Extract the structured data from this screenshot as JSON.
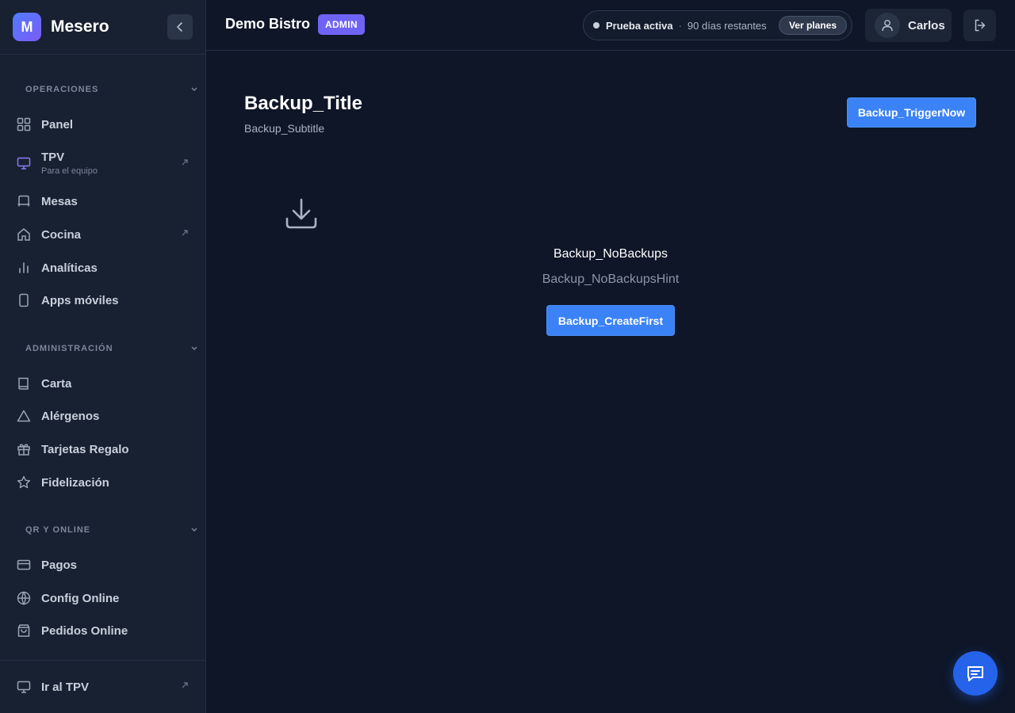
{
  "sidebar": {
    "logo_letter": "M",
    "app_name": "Mesero",
    "sections": [
      {
        "title": "OPERACIONES",
        "items": [
          {
            "label": "Panel",
            "icon": "grid-icon"
          },
          {
            "label": "TPV",
            "sublabel": "Para el equipo",
            "icon": "monitor-icon",
            "external": true,
            "accent": "#8b7cf6"
          },
          {
            "label": "Mesas",
            "icon": "table-icon"
          },
          {
            "label": "Cocina",
            "icon": "home-icon",
            "external": true
          },
          {
            "label": "Analíticas",
            "icon": "bar-chart-icon"
          },
          {
            "label": "Apps móviles",
            "icon": "smartphone-icon"
          }
        ]
      },
      {
        "title": "ADMINISTRACIÓN",
        "items": [
          {
            "label": "Carta",
            "icon": "book-icon"
          },
          {
            "label": "Alérgenos",
            "icon": "warning-icon"
          },
          {
            "label": "Tarjetas Regalo",
            "icon": "gift-icon"
          },
          {
            "label": "Fidelización",
            "icon": "star-icon"
          }
        ]
      },
      {
        "title": "QR Y ONLINE",
        "items": [
          {
            "label": "Pagos",
            "icon": "credit-card-icon"
          },
          {
            "label": "Config Online",
            "icon": "globe-icon"
          },
          {
            "label": "Pedidos Online",
            "icon": "shopping-bag-icon"
          }
        ]
      }
    ],
    "footer": {
      "label": "Ir al TPV",
      "icon": "monitor-icon"
    }
  },
  "header": {
    "business_name": "Demo Bistro",
    "role_badge": "ADMIN",
    "trial_status": "Prueba activa",
    "trial_separator": "·",
    "trial_days": "90 días restantes",
    "plans_button": "Ver planes",
    "user_name": "Carlos"
  },
  "main": {
    "title": "Backup_Title",
    "subtitle": "Backup_Subtitle",
    "trigger_button": "Backup_TriggerNow",
    "empty_title": "Backup_NoBackups",
    "empty_hint": "Backup_NoBackupsHint",
    "create_first_button": "Backup_CreateFirst"
  },
  "colors": {
    "accent": "#3b82f6",
    "background": "#0e1628",
    "sidebar": "#182131",
    "badge": "#6f63f5"
  }
}
